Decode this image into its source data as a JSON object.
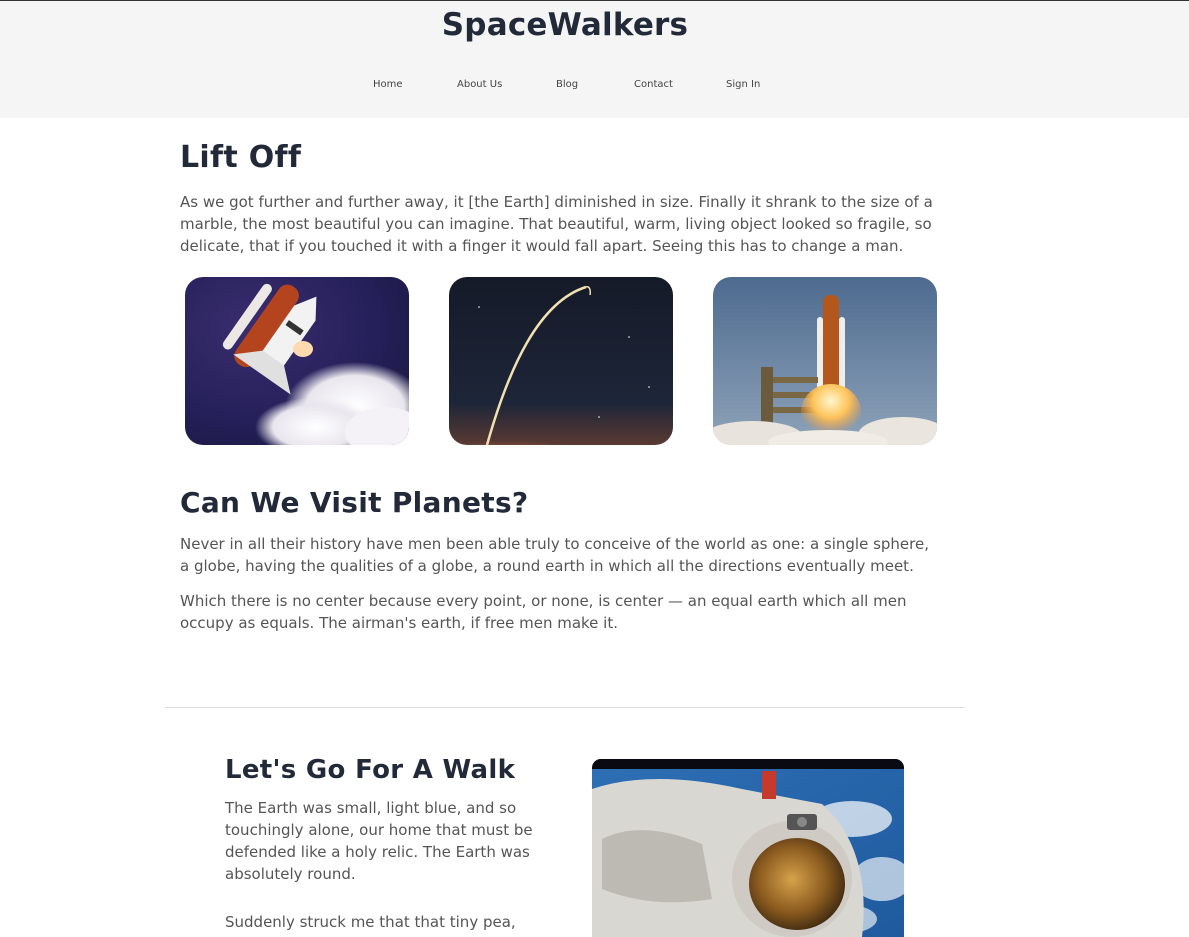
{
  "site": {
    "brand": "SpaceWalkers"
  },
  "nav": {
    "items": [
      "Home",
      "About Us",
      "Blog",
      "Contact",
      "Sign In"
    ]
  },
  "lift_off": {
    "heading": "Lift Off",
    "paragraph": "As we got further and further away, it [the Earth] diminished in size. Finally it shrank to the size of a marble, the most beautiful you can imagine. That beautiful, warm, living object looked so fragile, so delicate, that if you touched it with a finger it would fall apart. Seeing this has to change a man.",
    "images": [
      "space-shuttle-photo",
      "rocket-trail-photo",
      "launch-pad-photo"
    ]
  },
  "planets": {
    "heading": "Can We Visit Planets?",
    "paragraph1": "Never in all their history have men been able truly to conceive of the world as one: a single sphere, a globe, having the qualities of a globe, a round earth in which all the directions eventually meet.",
    "paragraph2": "Which there is no center because every point, or none, is center — an equal earth which all men occupy as equals. The airman's earth, if free men make it."
  },
  "walk": {
    "heading": "Let's Go For A Walk",
    "paragraph1": "The Earth was small, light blue, and so touchingly alone, our home that must be defended like a holy relic. The Earth was absolutely round.",
    "paragraph2": "Suddenly struck me that that tiny pea, pretty",
    "image": "astronaut-photo"
  }
}
